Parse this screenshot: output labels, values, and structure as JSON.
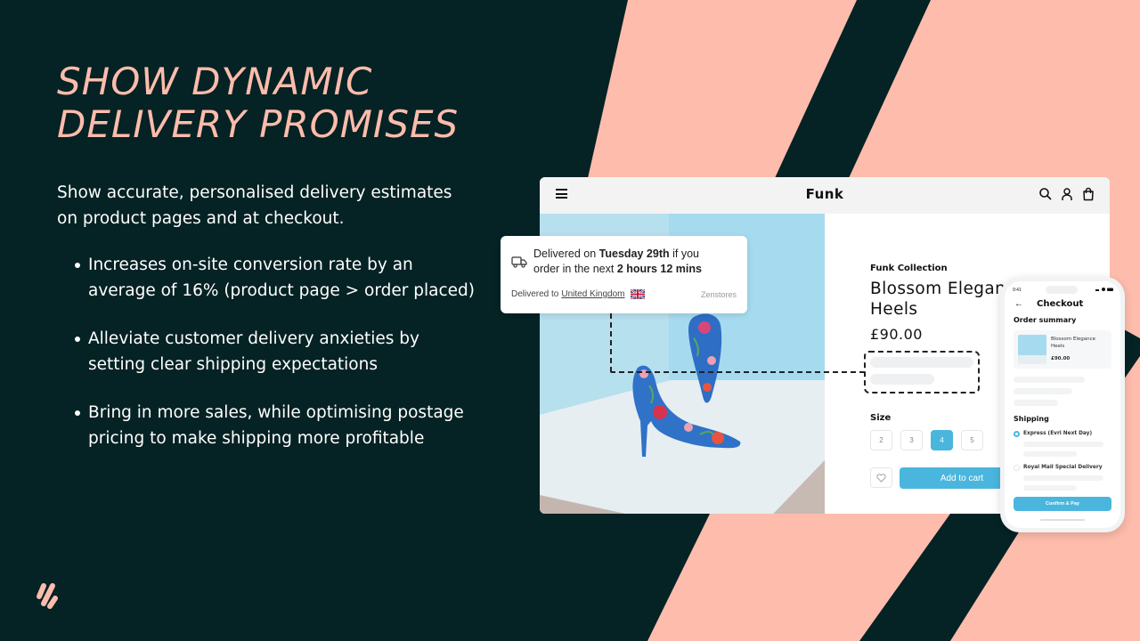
{
  "colors": {
    "background": "#052224",
    "accent_pink": "#fdbcac",
    "brand_blue": "#4bb6dd"
  },
  "headline": {
    "line1": "SHOW DYNAMIC",
    "line2": "DELIVERY PROMISES"
  },
  "intro": "Show accurate, personalised delivery estimates on product pages and at checkout.",
  "bullets": [
    "Increases on-site conversion rate by an average of 16% (product page > order placed)",
    "Alleviate customer delivery anxieties by setting clear shipping expectations",
    "Bring in more sales, while optimising postage pricing to make shipping more profitable"
  ],
  "logo_icon": "zenstores-logo-icon",
  "store": {
    "brand": "Funk",
    "header_icons": [
      "menu-icon",
      "search-icon",
      "user-icon",
      "bag-icon"
    ],
    "collection": "Funk Collection",
    "product_name_line1": "Blossom Elegance",
    "product_name_line2": "Heels",
    "price": "£90.00",
    "size_label": "Size",
    "sizes": [
      {
        "label": "2",
        "selected": false
      },
      {
        "label": "3",
        "selected": false
      },
      {
        "label": "4",
        "selected": true
      },
      {
        "label": "5",
        "selected": false
      }
    ],
    "wishlist_icon": "heart-icon",
    "add_to_cart": "Add to cart"
  },
  "delivery_widget": {
    "icon": "truck-icon",
    "prefix": "Delivered on ",
    "date": "Tuesday 29th",
    "middle1": " if you",
    "middle2": "order in the next ",
    "countdown": "2 hours 12 mins",
    "delivered_to_label": "Delivered to ",
    "country": "United Kingdom",
    "flag_icon": "uk-flag-icon",
    "provider": "Zenstores"
  },
  "phone": {
    "time": "9:41",
    "back_icon": "arrow-left-icon",
    "title": "Checkout",
    "order_summary": "Order summary",
    "item_name": "Blossom Elegance Heels",
    "item_price": "£90.00",
    "shipping_label": "Shipping",
    "options": [
      {
        "label": "Express (Evri Next Day)",
        "selected": true
      },
      {
        "label": "Royal Mail Special Delivery",
        "selected": false
      }
    ],
    "confirm": "Confirm & Pay"
  }
}
